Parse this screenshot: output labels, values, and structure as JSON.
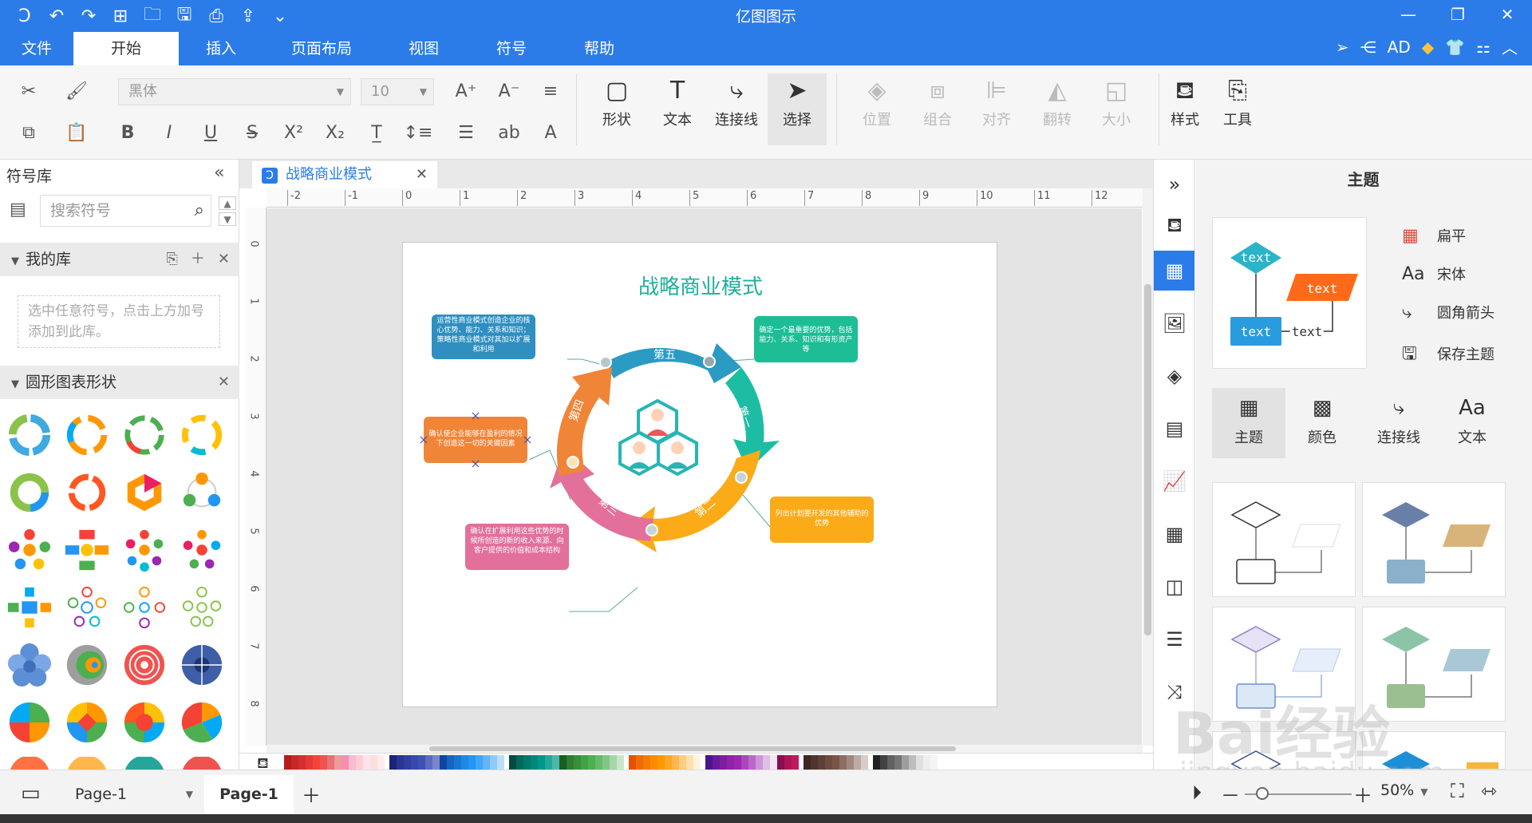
{
  "app": {
    "title": "亿图图示"
  },
  "menu": {
    "file": "文件",
    "tabs": [
      "开始",
      "插入",
      "页面布局",
      "视图",
      "符号",
      "帮助"
    ],
    "active": "开始",
    "user": "AD"
  },
  "ribbon": {
    "font_name": "黑体",
    "font_size": "10",
    "shape": "形状",
    "text": "文本",
    "connector": "连接线",
    "select": "选择",
    "position": "位置",
    "group": "组合",
    "align": "对齐",
    "flip": "翻转",
    "size": "大小",
    "style": "样式",
    "tools": "工具"
  },
  "left_panel": {
    "title": "符号库",
    "search_placeholder": "搜索符号",
    "my_library": "我的库",
    "my_library_hint": "选中任意符号，点击上方加号添加到此库。",
    "category": "圆形图表形状"
  },
  "document": {
    "tab_title": "战略商业模式",
    "diagram_title": "战略商业模式",
    "ruler_h": [
      "-2",
      "-1",
      "0",
      "1",
      "2",
      "3",
      "4",
      "5",
      "6",
      "7",
      "8",
      "9",
      "10",
      "11",
      "12"
    ],
    "ruler_v": [
      "0",
      "1",
      "2",
      "3",
      "4",
      "5",
      "6",
      "7",
      "8"
    ],
    "segments": [
      "第五",
      "第一",
      "第二",
      "第三",
      "第四"
    ],
    "boxes": {
      "blue": "运营性商业模式创造企业的核心优势、能力、关系和知识；策略性商业模式对其加以扩展和利用",
      "teal": "确定一个最重要的优势，包括能力、关系、知识和有形资产等",
      "orange": "确认使企业能够在盈利的情况下创造这一切的关键因素",
      "yellow": "列出计划要开发的其他辅助的优势",
      "pink": "确认在扩展利用这些优势的时候所创造的新的收入来源、向客户提供的价值和成本结构"
    }
  },
  "right_panel": {
    "title": "主题",
    "preview_text": "text",
    "options": [
      "扁平",
      "宋体",
      "圆角箭头",
      "保存主题"
    ],
    "categories": [
      "主题",
      "颜色",
      "连接线",
      "文本"
    ]
  },
  "status": {
    "page_select": "Page-1",
    "page_tab": "Page-1",
    "zoom": "50%"
  },
  "watermark": {
    "main": "Bai经验",
    "sub": "jingyan.baidu.com"
  }
}
